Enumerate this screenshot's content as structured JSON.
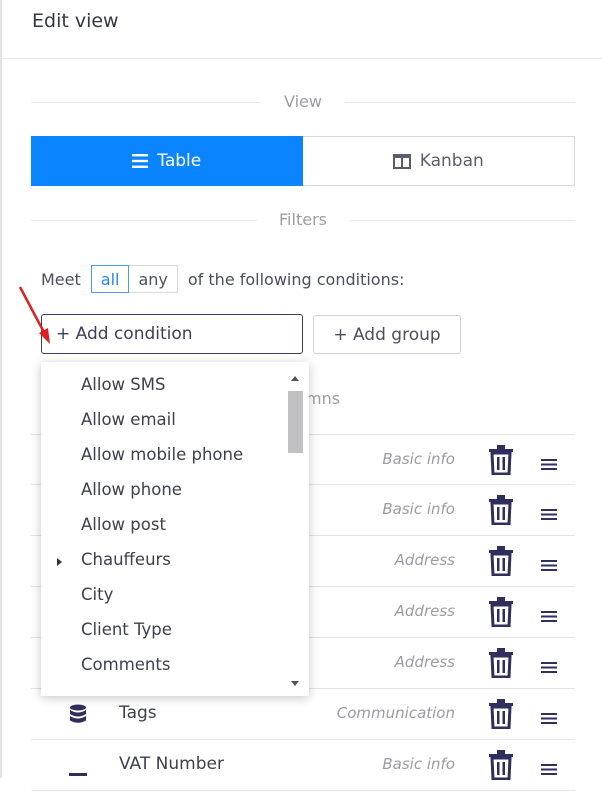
{
  "panel": {
    "title": "Edit view"
  },
  "view_section": {
    "label": "View",
    "options": [
      "Table",
      "Kanban"
    ],
    "selected": "Table"
  },
  "filters_section": {
    "label": "Filters",
    "meet_prefix": "Meet",
    "match_modes": [
      "all",
      "any"
    ],
    "selected_mode": "all",
    "meet_suffix": "of the following conditions:",
    "add_condition_label": "+ Add condition",
    "add_group_label": "+ Add group"
  },
  "columns_section": {
    "label_visible": "mns"
  },
  "condition_dropdown": {
    "items": [
      {
        "label": "Allow SMS",
        "has_submenu": false
      },
      {
        "label": "Allow email",
        "has_submenu": false
      },
      {
        "label": "Allow mobile phone",
        "has_submenu": false
      },
      {
        "label": "Allow phone",
        "has_submenu": false
      },
      {
        "label": "Allow post",
        "has_submenu": false
      },
      {
        "label": "Chauffeurs",
        "has_submenu": true
      },
      {
        "label": "City",
        "has_submenu": false
      },
      {
        "label": "Client Type",
        "has_submenu": false
      },
      {
        "label": "Comments",
        "has_submenu": false
      }
    ]
  },
  "column_rows": [
    {
      "name": "",
      "category": "Basic info",
      "icon": ""
    },
    {
      "name": "",
      "category": "Basic info",
      "icon": ""
    },
    {
      "name": "",
      "category": "Address",
      "icon": ""
    },
    {
      "name": "",
      "category": "Address",
      "icon": ""
    },
    {
      "name": "",
      "category": "Address",
      "icon": ""
    },
    {
      "name": "Tags",
      "category": "Communication",
      "icon": "database-icon"
    },
    {
      "name": "VAT Number",
      "category": "Basic info",
      "icon": "minus-icon"
    }
  ],
  "colors": {
    "accent": "#0a84ff",
    "icon_dark": "#2e2f5c",
    "arrow": "#e02020"
  }
}
